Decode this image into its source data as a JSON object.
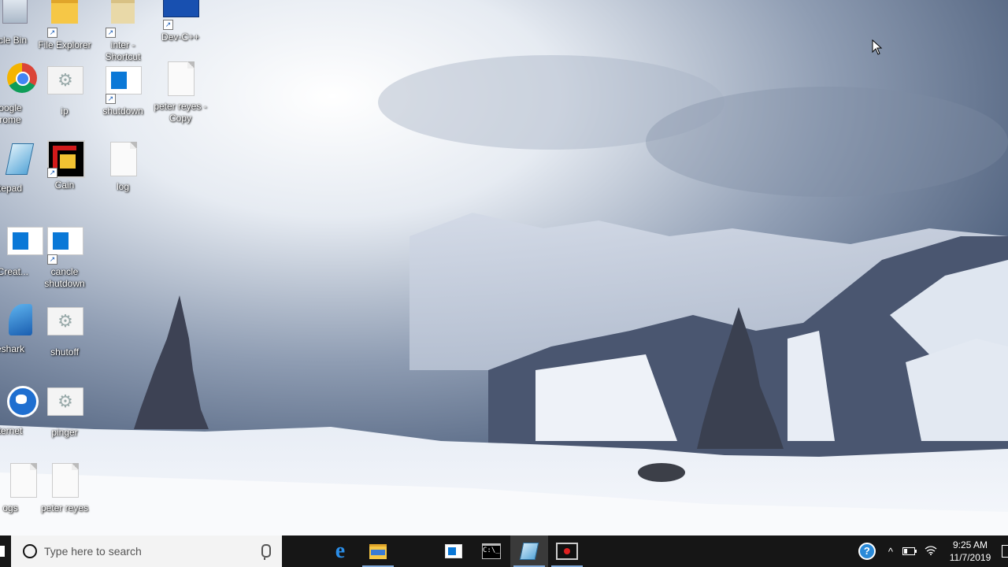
{
  "desktop": {
    "icons": [
      {
        "label": "ycle Bin",
        "kind": "recycle"
      },
      {
        "label": "File Explorer",
        "kind": "folder"
      },
      {
        "label": "inter - Shortcut",
        "kind": "folder-shortcut"
      },
      {
        "label": "Dev-C++",
        "kind": "devcpp"
      },
      {
        "label": "oogle\nrome",
        "kind": "chrome"
      },
      {
        "label": "ip",
        "kind": "gear"
      },
      {
        "label": "shutdown",
        "kind": "blue-app"
      },
      {
        "label": "peter reyes - Copy",
        "kind": "page"
      },
      {
        "label": "tepad",
        "kind": "notepad"
      },
      {
        "label": "Cain",
        "kind": "cain"
      },
      {
        "label": "log",
        "kind": "page"
      },
      {
        "label": "aCreat...",
        "kind": "blue-app"
      },
      {
        "label": "cancle shutdown",
        "kind": "blue-app"
      },
      {
        "label": "eshark",
        "kind": "wireshark"
      },
      {
        "label": "shutoff",
        "kind": "gear"
      },
      {
        "label": "ternet",
        "kind": "ie"
      },
      {
        "label": "pinger",
        "kind": "gear"
      },
      {
        "label": "ogs",
        "kind": "page"
      },
      {
        "label": "peter reyes",
        "kind": "page"
      }
    ]
  },
  "taskbar": {
    "search_placeholder": "Type here to search",
    "apps": [
      "edge-icon",
      "file-explorer-icon",
      "window-app-icon",
      "command-prompt-icon",
      "notepad-icon",
      "screen-recorder-icon"
    ],
    "cmd_glyph": "C:\\_",
    "help_glyph": "?",
    "chevron": "^",
    "clock_time": "9:25 AM",
    "clock_date": "11/7/2019"
  },
  "colors": {
    "taskbar_bg": "#161616",
    "search_bg": "#f3f3f3",
    "accent": "#0a78d7"
  }
}
